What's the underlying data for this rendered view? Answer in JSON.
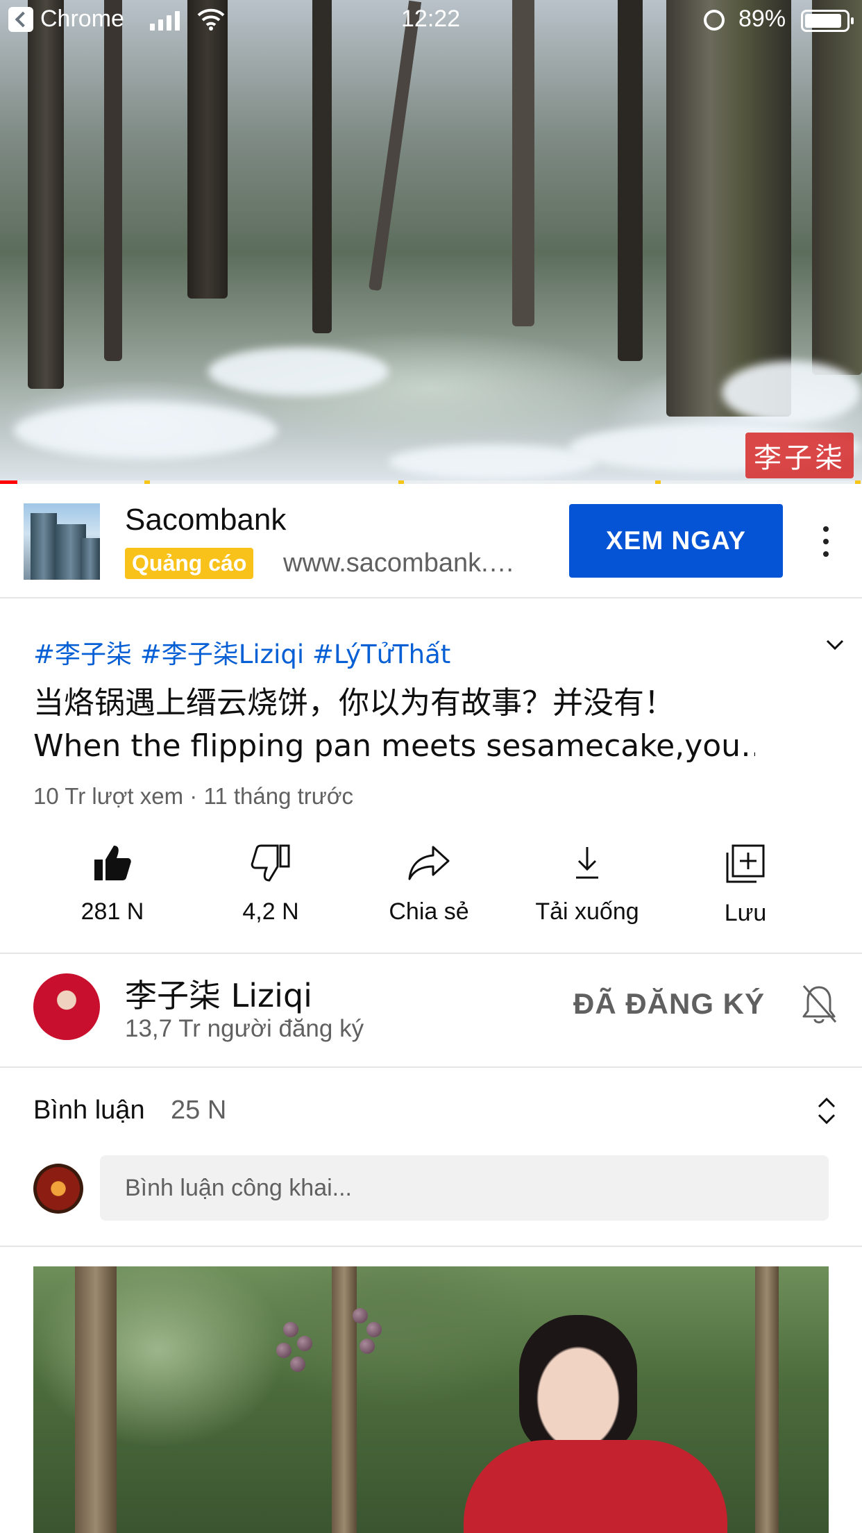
{
  "status_bar": {
    "back_app": "Chrome",
    "time": "12:22",
    "battery": "89%"
  },
  "player": {
    "watermark": "李子柒",
    "progress_fraction": 0.02
  },
  "ad": {
    "advertiser": "Sacombank",
    "badge": "Quảng cáo",
    "url": "www.sacombank.…",
    "cta": "XEM NGAY"
  },
  "video": {
    "hashtags": "#李子柒 #李子柒Liziqi #LýTửThất",
    "title_line1": "当烙锅遇上缙云烧饼，你以为有故事？并没有！",
    "title_line2": "When the flipping pan meets sesamecake,you…",
    "meta": "10 Tr lượt xem · 11 tháng trước"
  },
  "actions": {
    "like": "281 N",
    "dislike": "4,2 N",
    "share": "Chia sẻ",
    "download": "Tải xuống",
    "save": "Lưu"
  },
  "channel": {
    "name": "李子柒 Liziqi",
    "subscribers": "13,7 Tr người đăng ký",
    "subscribed_label": "ĐÃ ĐĂNG KÝ"
  },
  "comments": {
    "title": "Bình luận",
    "count": "25 N",
    "placeholder": "Bình luận công khai..."
  },
  "icons": {
    "back": "back-icon",
    "signal": "signal-icon",
    "wifi": "wifi-icon",
    "alarm": "alarm-icon",
    "battery": "battery-icon",
    "more": "more-vert-icon",
    "chevron": "chevron-down-icon",
    "like": "thumb-up-icon",
    "dislike": "thumb-down-icon",
    "share": "share-icon",
    "download": "download-icon",
    "save": "playlist-add-icon",
    "bell": "bell-off-icon",
    "sort": "unfold-icon"
  },
  "colors": {
    "accent_blue": "#0654d6",
    "link_blue": "#065fd4",
    "progress_red": "#ff0000",
    "ad_badge": "#f9c21b"
  }
}
